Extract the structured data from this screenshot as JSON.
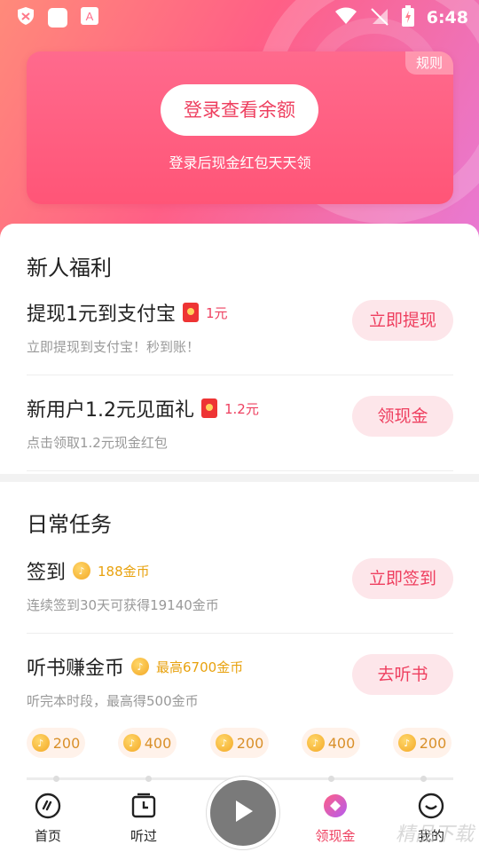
{
  "status_bar": {
    "time": "6:48"
  },
  "hero": {
    "rules_label": "规则",
    "login_button": "登录查看余额",
    "login_subtitle": "登录后现金红包天天领"
  },
  "newbie": {
    "title": "新人福利",
    "tasks": [
      {
        "name": "提现1元到支付宝",
        "reward": "1元",
        "sub": "立即提现到支付宝！秒到账！",
        "button": "立即提现"
      },
      {
        "name": "新用户1.2元见面礼",
        "reward": "1.2元",
        "sub": "点击领取1.2元现金红包",
        "button": "领现金"
      }
    ]
  },
  "daily": {
    "title": "日常任务",
    "tasks": [
      {
        "name": "签到",
        "reward": "188金币",
        "sub": "连续签到30天可获得19140金币",
        "button": "立即签到"
      },
      {
        "name": "听书赚金币",
        "reward": "最高6700金币",
        "sub": "听完本时段，最高得500金币",
        "button": "去听书"
      }
    ],
    "progress_rewards": [
      "200",
      "400",
      "200",
      "400",
      "200"
    ]
  },
  "bottom_nav": {
    "items": [
      {
        "label": "首页",
        "icon": "home-icon"
      },
      {
        "label": "听过",
        "icon": "history-icon"
      },
      {
        "label": "领现金",
        "icon": "cash-icon"
      },
      {
        "label": "我的",
        "icon": "profile-icon"
      }
    ],
    "play_icon": "play-icon"
  },
  "watermark": "精品下载",
  "colors": {
    "accent": "#ee3f5f",
    "button_bg": "#fde6ea",
    "gold": "#e8a20f"
  }
}
